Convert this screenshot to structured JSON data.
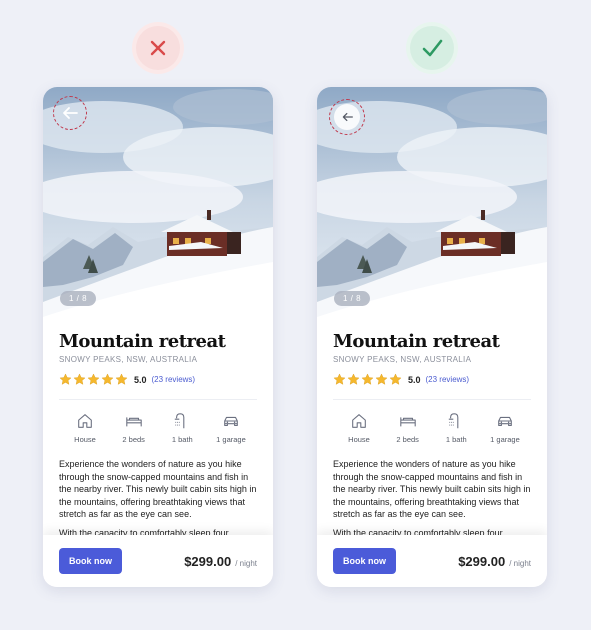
{
  "verdicts": {
    "bad_icon": "cross-icon",
    "good_icon": "check-icon",
    "bad_color": "#d94a4a",
    "good_color": "#2e9a63"
  },
  "listing": {
    "image_counter": "1 / 8",
    "title": "Mountain retreat",
    "location": "SNOWY PEAKS, NSW, AUSTRALIA",
    "rating": "5.0",
    "rating_value": 5,
    "reviews": "(23 reviews)",
    "features": [
      {
        "icon": "house-icon",
        "label": "House"
      },
      {
        "icon": "bed-icon",
        "label": "2 beds"
      },
      {
        "icon": "shower-icon",
        "label": "1 bath"
      },
      {
        "icon": "car-icon",
        "label": "1 garage"
      }
    ],
    "description": "Experience the wonders of nature as you hike through the snow-capped mountains and fish in the nearby river. This newly built cabin sits high in the mountains, offering breathtaking views that stretch as far as the eye can see.",
    "description_more": "With the capacity to comfortably sleep four",
    "book_label": "Book now",
    "price": "$299.00",
    "price_unit": "/ night",
    "accent_color": "#4b5bd9",
    "star_color": "#f5b82e"
  }
}
